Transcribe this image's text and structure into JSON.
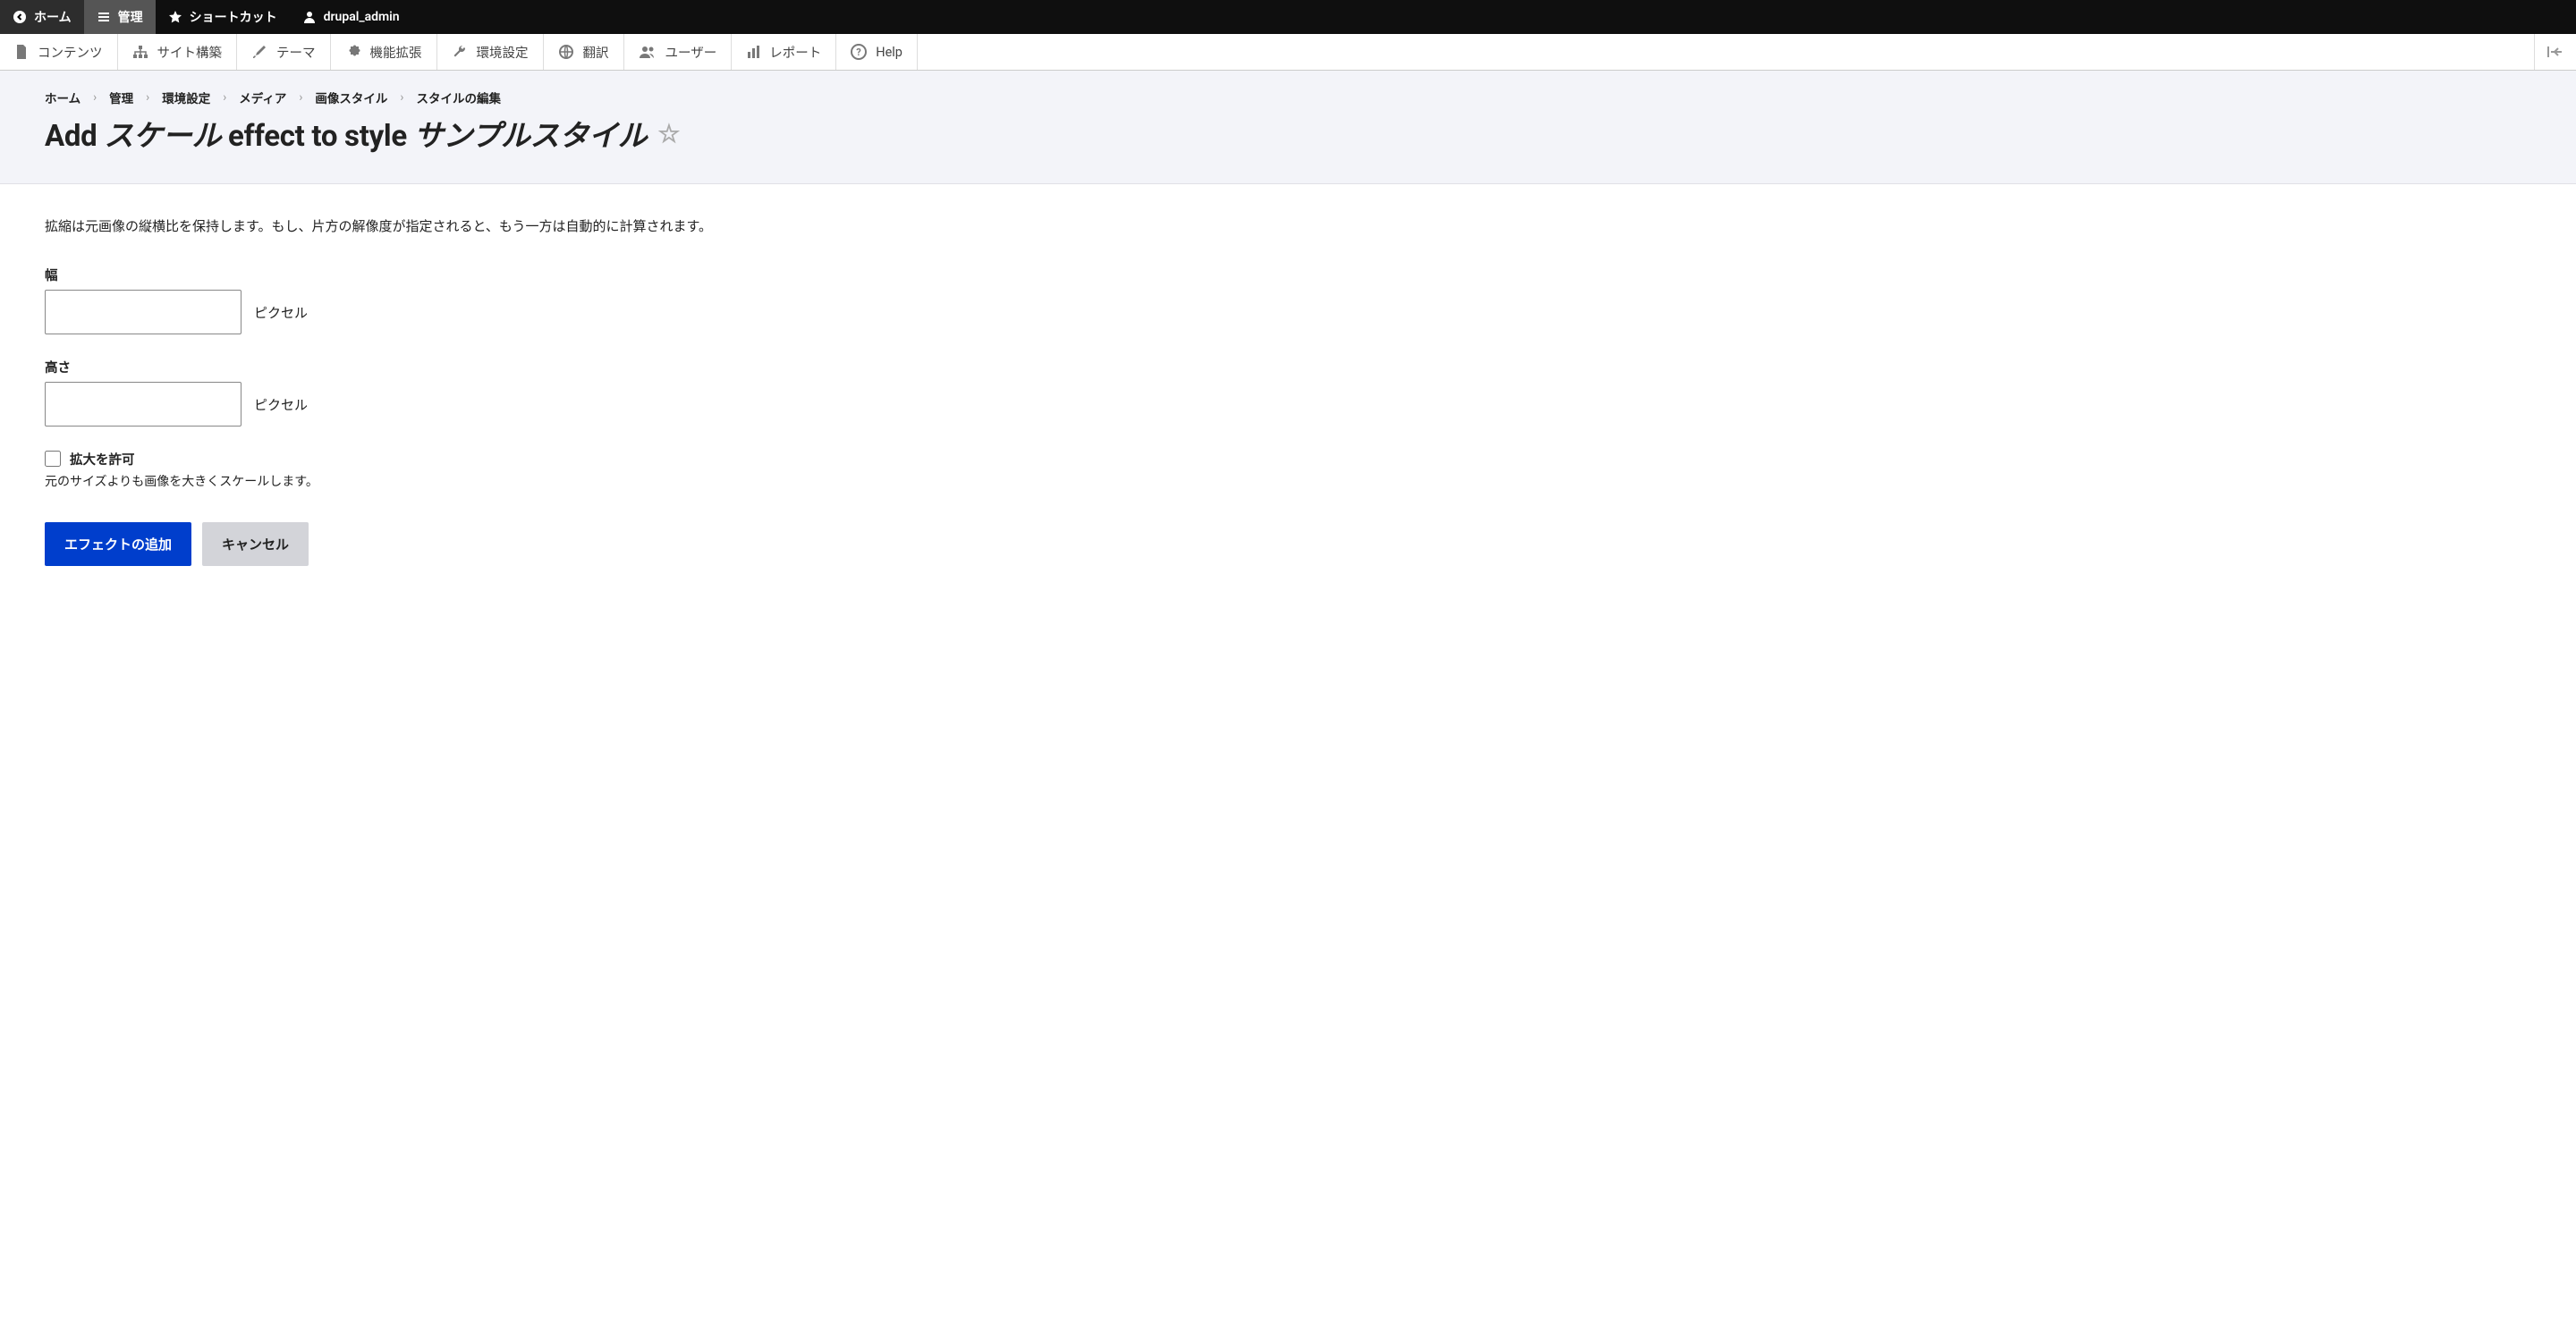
{
  "toolbar_top": {
    "back_label": "ホーム",
    "manage_label": "管理",
    "shortcuts_label": "ショートカット",
    "user_label": "drupal_admin"
  },
  "admin_menu": {
    "items": [
      {
        "label": "コンテンツ",
        "icon": "file"
      },
      {
        "label": "サイト構築",
        "icon": "sitemap"
      },
      {
        "label": "テーマ",
        "icon": "paintbrush"
      },
      {
        "label": "機能拡張",
        "icon": "puzzle"
      },
      {
        "label": "環境設定",
        "icon": "wrench"
      },
      {
        "label": "翻訳",
        "icon": "globe"
      },
      {
        "label": "ユーザー",
        "icon": "users"
      },
      {
        "label": "レポート",
        "icon": "chart"
      },
      {
        "label": "Help",
        "icon": "help"
      }
    ]
  },
  "breadcrumb": {
    "items": [
      "ホーム",
      "管理",
      "環境設定",
      "メディア",
      "画像スタイル",
      "スタイルの編集"
    ]
  },
  "page_title": {
    "part1": "Add ",
    "italic1": "スケール",
    "part2": " effect to style ",
    "italic2": "サンプルスタイル"
  },
  "form": {
    "description": "拡縮は元画像の縦横比を保持します。もし、片方の解像度が指定されると、もう一方は自動的に計算されます。",
    "width": {
      "label": "幅",
      "value": "",
      "suffix": "ピクセル"
    },
    "height": {
      "label": "高さ",
      "value": "",
      "suffix": "ピクセル"
    },
    "upscale": {
      "label": "拡大を許可",
      "description": "元のサイズよりも画像を大きくスケールします。",
      "checked": false
    }
  },
  "actions": {
    "submit": "エフェクトの追加",
    "cancel": "キャンセル"
  },
  "breadcrumb_separator": "›"
}
